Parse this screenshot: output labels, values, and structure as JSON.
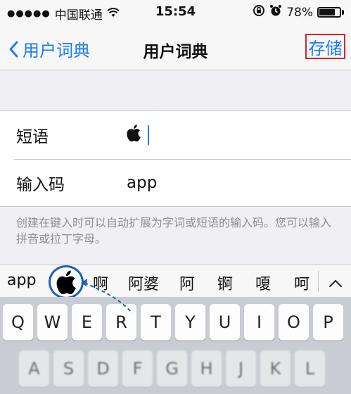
{
  "status_bar": {
    "signal_dots": "●●●●●",
    "carrier": "中国联通",
    "wifi_icon": "wifi-icon",
    "time": "15:54",
    "battery_percent": "78%",
    "battery_level": 0.78
  },
  "nav": {
    "back_label": "用户词典",
    "title": "用户词典",
    "save_label": "存储",
    "accent_color": "#1e7ef4",
    "highlight_color": "#d8242b"
  },
  "form": {
    "phrase_label": "短语",
    "phrase_value": "",
    "shortcut_label": "输入码",
    "shortcut_value": "app"
  },
  "hint": "创建在键入时可以自动扩展为字词或短语的输入码。您可以输入拼音或拉丁字母。",
  "candidates": {
    "typed": "app",
    "items": [
      "啊",
      "阿婆",
      "阿",
      "锕",
      "嗄",
      "呵"
    ]
  },
  "keyboard": {
    "row1": [
      "Q",
      "W",
      "E",
      "R",
      "T",
      "Y",
      "U",
      "I",
      "O",
      "P"
    ],
    "row2": [
      "A",
      "S",
      "D",
      "F",
      "G",
      "H",
      "J",
      "K",
      "L"
    ]
  }
}
